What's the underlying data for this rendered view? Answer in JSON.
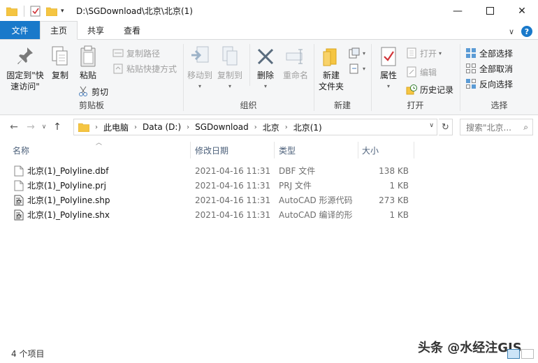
{
  "window": {
    "title_path": "D:\\SGDownload\\北京\\北京(1)"
  },
  "ribbon_tabs": {
    "file": "文件",
    "home": "主页",
    "share": "共享",
    "view": "查看"
  },
  "ribbon": {
    "clipboard": {
      "pin_label": "固定到\"快速访问\"",
      "copy": "复制",
      "paste": "粘贴",
      "copy_path": "复制路径",
      "paste_shortcut": "粘贴快捷方式",
      "cut": "剪切",
      "group": "剪贴板"
    },
    "organize": {
      "move_to": "移动到",
      "copy_to": "复制到",
      "delete": "删除",
      "rename": "重命名",
      "group": "组织"
    },
    "new": {
      "new_folder": "新建\n文件夹",
      "new_folder_l1": "新建",
      "new_folder_l2": "文件夹",
      "group": "新建"
    },
    "open": {
      "properties": "属性",
      "open": "打开",
      "edit": "编辑",
      "history": "历史记录",
      "group": "打开"
    },
    "select": {
      "select_all": "全部选择",
      "select_none": "全部取消",
      "invert": "反向选择",
      "group": "选择"
    }
  },
  "address": {
    "crumbs": [
      "此电脑",
      "Data (D:)",
      "SGDownload",
      "北京",
      "北京(1)"
    ],
    "search_placeholder": "搜索\"北京..."
  },
  "columns": {
    "name": "名称",
    "date": "修改日期",
    "type": "类型",
    "size": "大小"
  },
  "files": [
    {
      "name": "北京(1)_Polyline.dbf",
      "date": "2021-04-16 11:31",
      "type": "DBF 文件",
      "size": "138 KB",
      "icon": "blank-file-icon"
    },
    {
      "name": "北京(1)_Polyline.prj",
      "date": "2021-04-16 11:31",
      "type": "PRJ 文件",
      "size": "1 KB",
      "icon": "blank-file-icon"
    },
    {
      "name": "北京(1)_Polyline.shp",
      "date": "2021-04-16 11:31",
      "type": "AutoCAD 形源代码",
      "size": "273 KB",
      "icon": "autocad-shape-file-icon"
    },
    {
      "name": "北京(1)_Polyline.shx",
      "date": "2021-04-16 11:31",
      "type": "AutoCAD 编译的形",
      "size": "1 KB",
      "icon": "autocad-shape-file-icon"
    }
  ],
  "status": {
    "item_count": "4 个项目"
  },
  "watermark": "头条 @水经注GIS",
  "colors": {
    "accent": "#1979ca",
    "ribbon_bg": "#f5f6f7",
    "folder_yellow": "#f5c542"
  }
}
